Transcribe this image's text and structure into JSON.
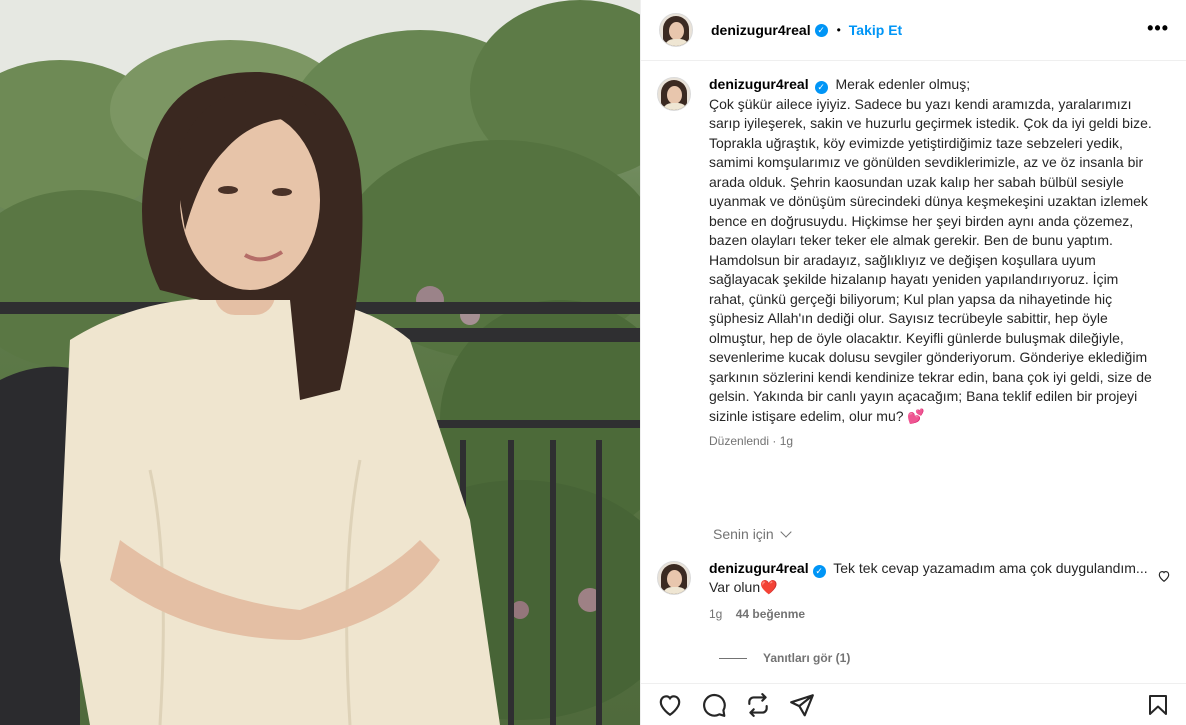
{
  "header": {
    "username": "denizugur4real",
    "separator": "•",
    "follow_label": "Takip Et",
    "more_label": "•••"
  },
  "caption": {
    "username": "denizugur4real",
    "text": "Merak edenler olmuş;\nÇok şükür ailece iyiyiz. Sadece bu yazı kendi aramızda, yaralarımızı sarıp iyileşerek, sakin ve huzurlu geçirmek istedik. Çok da iyi geldi bize. Toprakla uğraştık, köy evimizde yetiştirdiğimiz taze sebzeleri yedik, samimi komşularımız ve gönülden sevdiklerimizle, az ve öz insanla bir arada olduk. Şehrin kaosundan uzak kalıp her sabah bülbül sesiyle uyanmak ve dönüşüm sürecindeki dünya keşmekeşini uzaktan izlemek bence en doğrusuydu. Hiçkimse her şeyi birden aynı anda çözemez, bazen olayları teker teker ele almak gerekir. Ben de bunu yaptım. Hamdolsun bir aradayız, sağlıklıyız ve değişen koşullara uyum sağlayacak şekilde hizalanıp hayatı yeniden yapılandırıyoruz. İçim rahat, çünkü gerçeği biliyorum; Kul plan yapsa da nihayetinde hiç şüphesiz Allah'ın dediği olur. Sayısız tecrübeyle sabittir, hep öyle olmuştur, hep de öyle olacaktır. Keyifli günlerde buluşmak dileğiyle, sevenlerime kucak dolusu sevgiler gönderiyorum. Gönderiye eklediğim şarkının sözlerini kendi kendinize tekrar edin, bana çok iyi geldi, size de gelsin. Yakında bir canlı yayın açacağım; Bana teklif edilen bir projeyi sizinle istişare edelim, olur mu? 💕",
    "meta": "Düzenlendi · 1g"
  },
  "for_you": {
    "label": "Senin için"
  },
  "comment": {
    "username": "denizugur4real",
    "text": "Tek tek cevap yazamadım ama çok duygulandım... Var olun❤️",
    "time": "1g",
    "likes": "44 beğenme"
  },
  "replies": {
    "label": "Yanıtları gör (1)"
  },
  "icons": {
    "verified": "verified-badge-icon",
    "like": "heart-icon",
    "comment": "comment-icon",
    "repost": "repost-icon",
    "share": "share-icon",
    "save": "bookmark-icon"
  },
  "colors": {
    "accent": "#0095f6",
    "secondary_text": "#737373",
    "divider": "#efefef"
  }
}
